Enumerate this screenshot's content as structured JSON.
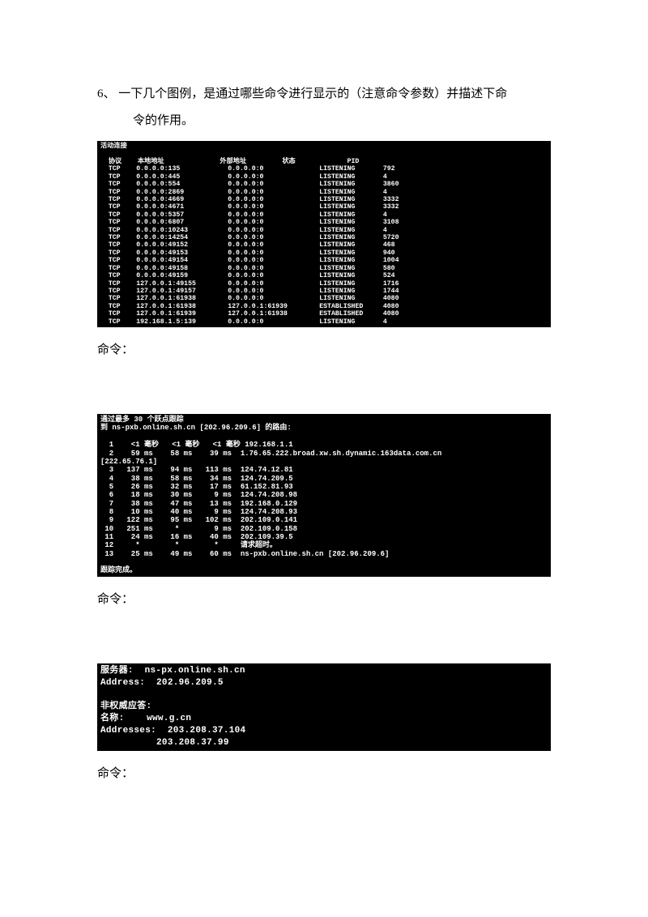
{
  "question": {
    "number": "6、",
    "line1": "一下几个图例，是通过哪些命令进行显示的（注意命令参数）并描述下命",
    "line2": "令的作用。"
  },
  "cmd_label": "命令：",
  "terminal1": {
    "title": "活动连接",
    "headers": "  协议    本地地址              外部地址         状态             PID",
    "rows": [
      "  TCP    0.0.0.0:135            0.0.0.0:0              LISTENING       792",
      "  TCP    0.0.0.0:445            0.0.0.0:0              LISTENING       4",
      "  TCP    0.0.0.0:554            0.0.0.0:0              LISTENING       3860",
      "  TCP    0.0.0.0:2869           0.0.0.0:0              LISTENING       4",
      "  TCP    0.0.0.0:4669           0.0.0.0:0              LISTENING       3332",
      "  TCP    0.0.0.0:4671           0.0.0.0:0              LISTENING       3332",
      "  TCP    0.0.0.0:5357           0.0.0.0:0              LISTENING       4",
      "  TCP    0.0.0.0:6807           0.0.0.0:0              LISTENING       3108",
      "  TCP    0.0.0.0:10243          0.0.0.0:0              LISTENING       4",
      "  TCP    0.0.0.0:14254          0.0.0.0:0              LISTENING       5720",
      "  TCP    0.0.0.0:49152          0.0.0.0:0              LISTENING       468",
      "  TCP    0.0.0.0:49153          0.0.0.0:0              LISTENING       940",
      "  TCP    0.0.0.0:49154          0.0.0.0:0              LISTENING       1004",
      "  TCP    0.0.0.0:49158          0.0.0.0:0              LISTENING       580",
      "  TCP    0.0.0.0:49159          0.0.0.0:0              LISTENING       524",
      "  TCP    127.0.0.1:49155        0.0.0.0:0              LISTENING       1716",
      "  TCP    127.0.0.1:49157        0.0.0.0:0              LISTENING       1744",
      "  TCP    127.0.0.1:61938        0.0.0.0:0              LISTENING       4080",
      "  TCP    127.0.0.1:61938        127.0.0.1:61939        ESTABLISHED     4080",
      "  TCP    127.0.0.1:61939        127.0.0.1:61938        ESTABLISHED     4080",
      "  TCP    192.168.1.5:139        0.0.0.0:0              LISTENING       4"
    ]
  },
  "terminal2": {
    "line1": "通过最多 30 个跃点跟踪",
    "line2": "到 ns-pxb.online.sh.cn [202.96.209.6] 的路由:",
    "rows": [
      "",
      "  1    <1 毫秒   <1 毫秒   <1 毫秒 192.168.1.1",
      "  2    59 ms    58 ms    39 ms  1.76.65.222.broad.xw.sh.dynamic.163data.com.cn",
      "[222.65.76.1]",
      "  3   137 ms    94 ms   113 ms  124.74.12.81",
      "  4    38 ms    58 ms    34 ms  124.74.209.5",
      "  5    26 ms    32 ms    17 ms  61.152.81.93",
      "  6    18 ms    30 ms     9 ms  124.74.208.98",
      "  7    38 ms    47 ms    13 ms  192.168.0.129",
      "  8    10 ms    40 ms     9 ms  124.74.208.93",
      "  9   122 ms    95 ms   102 ms  202.109.0.141",
      " 10   251 ms     *        9 ms  202.109.0.158",
      " 11    24 ms    16 ms    40 ms  202.109.39.5",
      " 12     *        *        *     请求超时。",
      " 13    25 ms    49 ms    60 ms  ns-pxb.online.sh.cn [202.96.209.6]",
      "",
      "跟踪完成。"
    ]
  },
  "terminal3": {
    "rows": [
      "服务器:  ns-px.online.sh.cn",
      "Address:  202.96.209.5",
      "",
      "非权威应答:",
      "名称:    www.g.cn",
      "Addresses:  203.208.37.104",
      "          203.208.37.99",
      ""
    ]
  }
}
